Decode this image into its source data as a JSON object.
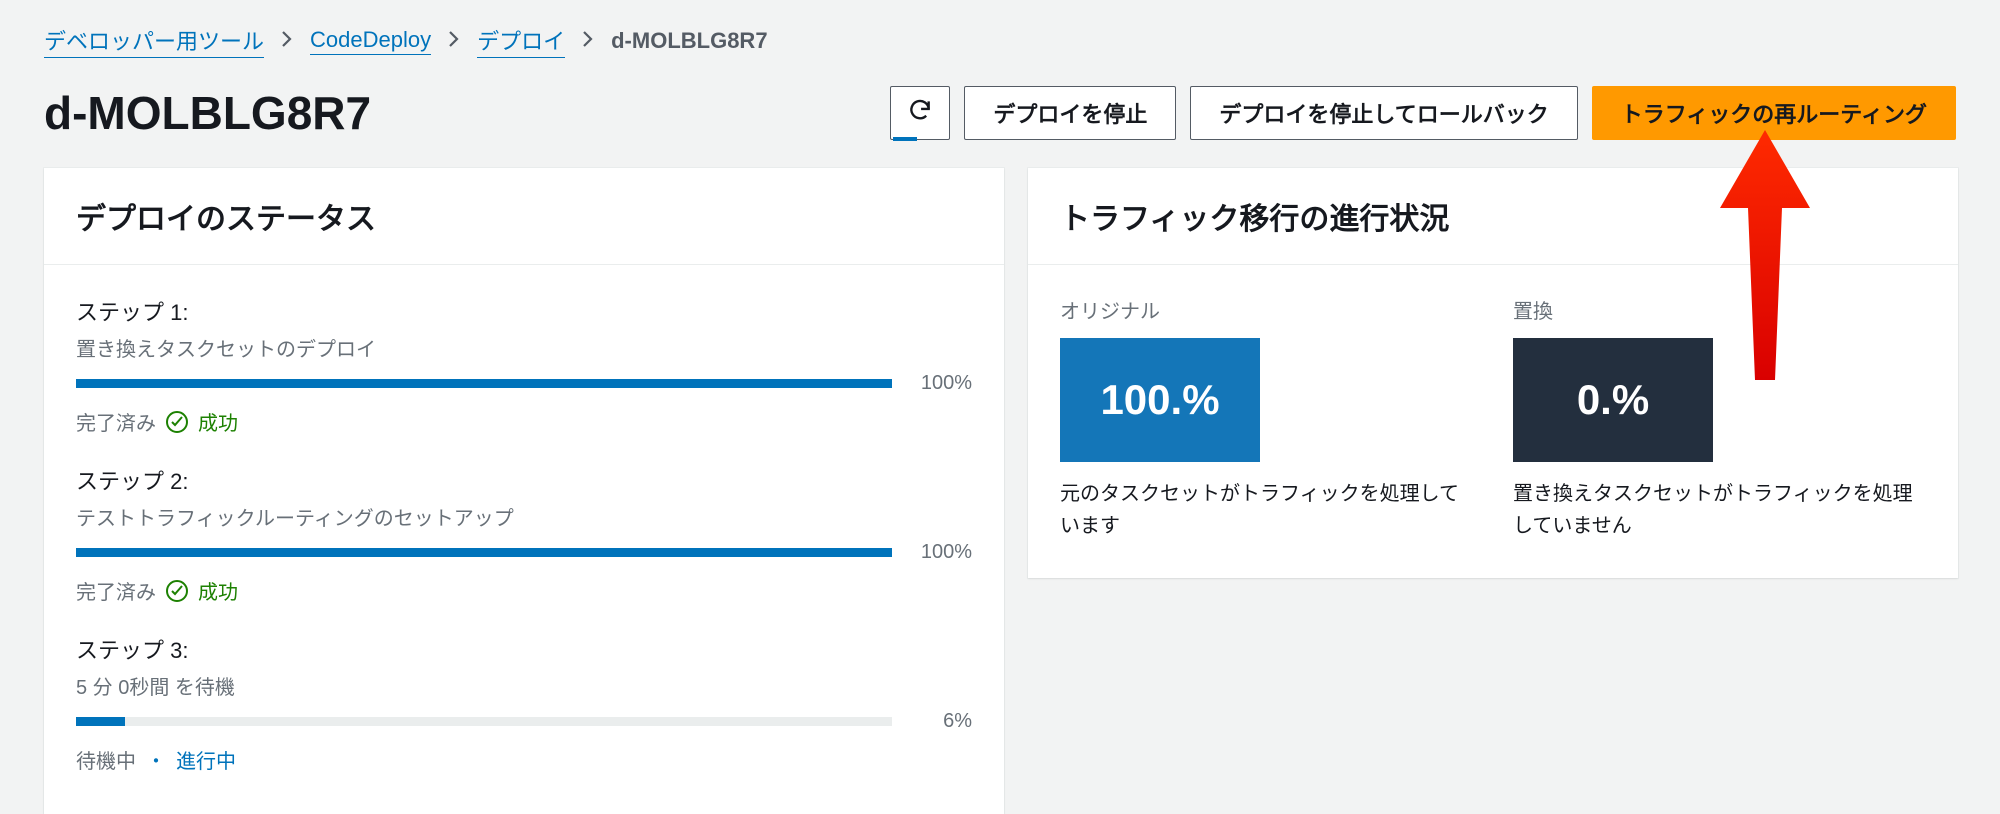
{
  "breadcrumbs": {
    "items": [
      "デベロッパー用ツール",
      "CodeDeploy",
      "デプロイ"
    ],
    "current": "d-MOLBLG8R7"
  },
  "page_title": "d-MOLBLG8R7",
  "actions": {
    "refresh_icon": "refresh",
    "stop_deploy": "デプロイを停止",
    "stop_rollback": "デプロイを停止してロールバック",
    "reroute_traffic": "トラフィックの再ルーティング"
  },
  "deploy_status": {
    "title": "デプロイのステータス",
    "steps": [
      {
        "title": "ステップ 1:",
        "desc": "置き換えタスクセットのデプロイ",
        "progress": 100,
        "progress_label": "100%",
        "completed_label": "完了済み",
        "result_label": "成功",
        "state": "done"
      },
      {
        "title": "ステップ 2:",
        "desc": "テストトラフィックルーティングのセットアップ",
        "progress": 100,
        "progress_label": "100%",
        "completed_label": "完了済み",
        "result_label": "成功",
        "state": "done"
      },
      {
        "title": "ステップ 3:",
        "desc": "5 分 0秒間 を待機",
        "progress": 6,
        "progress_label": "6%",
        "waiting_label": "待機中",
        "inprogress_label": "進行中",
        "state": "inprogress"
      }
    ]
  },
  "traffic": {
    "title": "トラフィック移行の進行状況",
    "original": {
      "label": "オリジナル",
      "value": "100.%",
      "desc": "元のタスクセットがトラフィックを処理しています"
    },
    "replacement": {
      "label": "置換",
      "value": "0.%",
      "desc": "置き換えタスクセットがトラフィックを処理していません"
    }
  }
}
